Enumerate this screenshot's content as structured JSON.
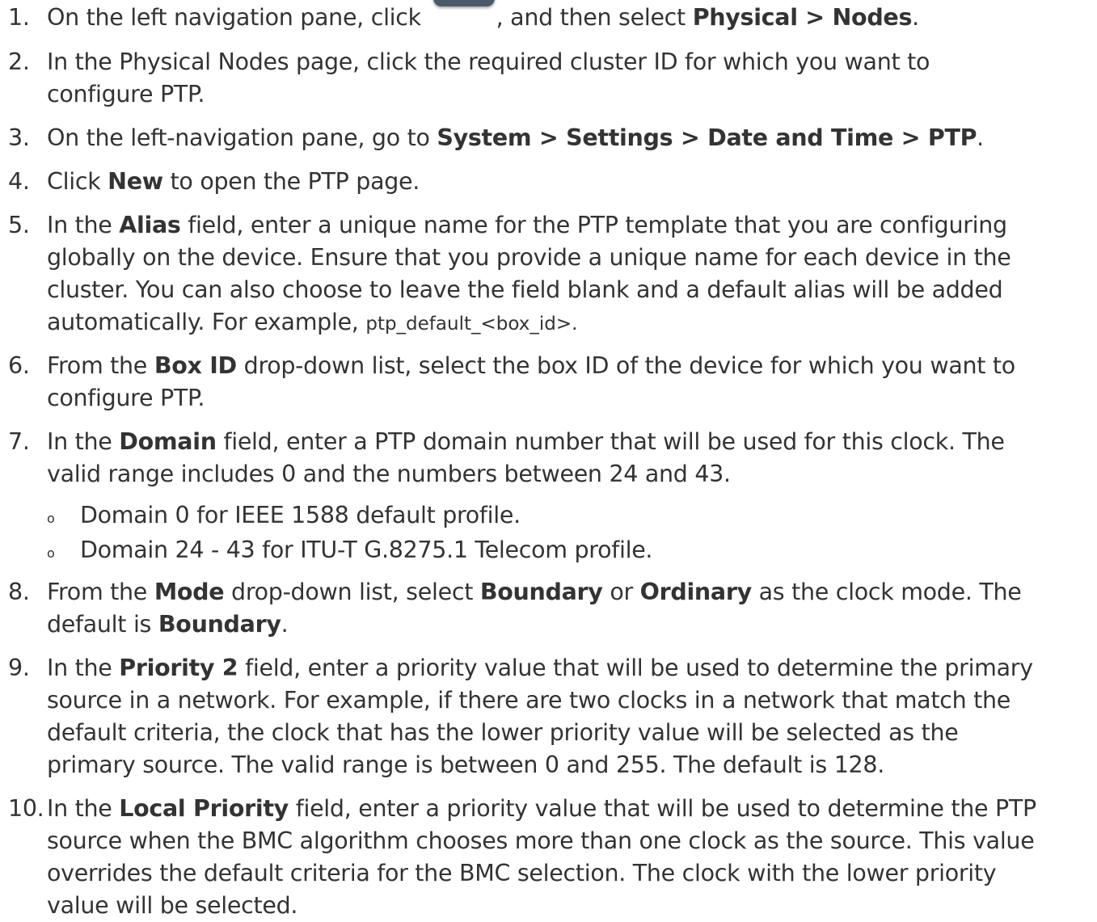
{
  "steps": [
    {
      "num": "1.",
      "a": "On the left navigation pane, click",
      "b": ", and then select ",
      "c": "Physical > Nodes",
      "d": "."
    },
    {
      "num": "2.",
      "l1": "In the Physical Nodes page, click the required cluster ID for which you want to",
      "l2": "configure PTP."
    },
    {
      "num": "3.",
      "a": "On the left-navigation pane, go to ",
      "b": "System > Settings > Date and Time > PTP",
      "c": "."
    },
    {
      "num": "4.",
      "a": "Click ",
      "b": "New",
      "c": " to open the PTP page."
    },
    {
      "num": "5.",
      "a": "In the ",
      "b": "Alias",
      "c": " field, enter a unique name for the PTP template that you are configuring",
      "l2": "globally on the device. Ensure that you provide a unique name for each device in the",
      "l3": "cluster. You can also choose to leave the field blank and a default alias will be added",
      "l4a": "automatically. For example, ",
      "l4code": "ptp_default_<box_id>",
      "l4b": "."
    },
    {
      "num": "6.",
      "a": "From the ",
      "b": "Box ID",
      "c": " drop-down list, select the box ID of the device for which you want to",
      "l2": "configure PTP."
    },
    {
      "num": "7.",
      "a": "In the ",
      "b": "Domain",
      "c": " field, enter a PTP domain number that will be used for this clock. The",
      "l2": "valid range includes 0 and the numbers between 24 and 43.",
      "sub": [
        "Domain 0 for IEEE 1588 default profile.",
        "Domain 24 - 43 for ITU-T G.8275.1 Telecom profile."
      ],
      "bullet": "o"
    },
    {
      "num": "8.",
      "a": "From the ",
      "b": "Mode",
      "c": " drop-down list, select ",
      "d": "Boundary",
      "e": " or ",
      "f": "Ordinary",
      "g": " as the clock mode. The",
      "l2a": "default is ",
      "l2b": "Boundary",
      "l2c": "."
    },
    {
      "num": "9.",
      "a": "In the ",
      "b": "Priority 2",
      "c": " field, enter a priority value that will be used to determine the primary",
      "l2": "source in a network. For example, if there are two clocks in a network that match the",
      "l3": "default criteria, the clock that has the lower priority value will be selected as the",
      "l4": "primary source. The valid range is between 0 and 255. The default is 128."
    },
    {
      "num": "10.",
      "a": "In the ",
      "b": "Local Priority",
      "c": " field, enter a priority value that will be used to determine the PTP",
      "l2": "source when the BMC algorithm chooses more than one clock as the source. This value",
      "l3": "overrides the default criteria for the BMC selection. The clock with the lower priority",
      "l4": "value will be selected."
    }
  ]
}
